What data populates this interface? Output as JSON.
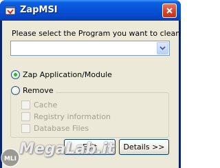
{
  "window": {
    "title": "ZapMSI",
    "title_icon": "zapmsi-app-icon",
    "close_icon": "close-icon"
  },
  "main": {
    "prompt": "Please select the Program you want to clean up",
    "program_select": {
      "value": "",
      "dropdown_icon": "chevron-down-icon"
    },
    "options": {
      "zap_label": "Zap Application/Module",
      "zap_selected": true,
      "remove_label": "Remove",
      "remove_selected": false
    },
    "remove_items": {
      "cache": "Cache",
      "registry": "Registry information",
      "database": "Database Files"
    }
  },
  "buttons": {
    "exit": "Exit",
    "details": "Details >>"
  },
  "watermark": {
    "text": "MegaLab.it",
    "logo_text": "MLI"
  }
}
